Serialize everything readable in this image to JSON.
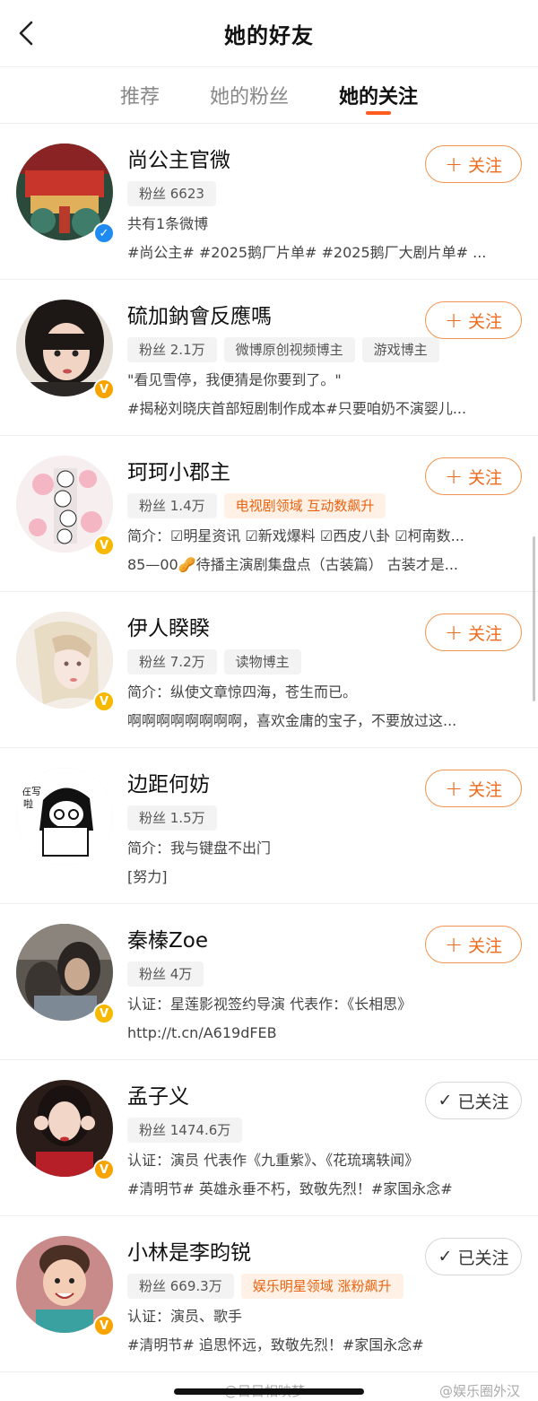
{
  "header": {
    "title": "她的好友",
    "back_icon": "chevron-left-icon"
  },
  "tabs": [
    {
      "label": "推荐",
      "active": false
    },
    {
      "label": "她的粉丝",
      "active": false
    },
    {
      "label": "她的关注",
      "active": true
    }
  ],
  "follow_label": "关注",
  "followed_label": "已关注",
  "items": [
    {
      "name": "尚公主官微",
      "verify": "blue",
      "tags": [
        "粉丝 6623"
      ],
      "hot": "",
      "line1": "共有1条微博",
      "line2": "#尚公主# #2025鹅厂片单# #2025鹅厂大剧片单# ...",
      "followed": false
    },
    {
      "name": "硫加鈉會反應嗎",
      "verify": "orange",
      "tags": [
        "粉丝 2.1万",
        "微博原创视频博主",
        "游戏博主"
      ],
      "hot": "",
      "line1": "\"看见雪停，我便猜是你要到了。\"",
      "line2": "#揭秘刘晓庆首部短剧制作成本#只要咱奶不演婴儿...",
      "followed": false
    },
    {
      "name": "珂珂小郡主",
      "verify": "gold",
      "tags": [
        "粉丝 1.4万"
      ],
      "hot": "电视剧领域 互动数飙升",
      "line1": "简介：☑明星资讯 ☑新戏爆料 ☑西皮八卦 ☑柯南数...",
      "line2": "85—00🥜待播主演剧集盘点（古装篇） 古装才是...",
      "followed": false
    },
    {
      "name": "伊人睽睽",
      "verify": "gold",
      "tags": [
        "粉丝 7.2万",
        "读物博主"
      ],
      "hot": "",
      "line1": "简介：纵使文章惊四海，苍生而已。",
      "line2": "啊啊啊啊啊啊啊啊，喜欢金庸的宝子，不要放过这...",
      "followed": false
    },
    {
      "name": "边距何妨",
      "verify": "",
      "tags": [
        "粉丝 1.5万"
      ],
      "hot": "",
      "line1": "简介：我与键盘不出门",
      "line2": "[努力]",
      "followed": false
    },
    {
      "name": "秦榛Zoe",
      "verify": "gold",
      "tags": [
        "粉丝 4万"
      ],
      "hot": "",
      "line1": "认证：星莲影视签约导演 代表作：《长相思》",
      "line2": "http://t.cn/A619dFEB",
      "followed": false
    },
    {
      "name": "孟子义",
      "verify": "orange",
      "tags": [
        "粉丝 1474.6万"
      ],
      "hot": "",
      "line1": "认证：演员 代表作《九重紫》、《花琉璃轶闻》",
      "line2": "#清明节# 英雄永垂不朽，致敬先烈！#家国永念#",
      "followed": true
    },
    {
      "name": "小林是李昀锐",
      "verify": "orange",
      "tags": [
        "粉丝 669.3万"
      ],
      "hot": "娱乐明星领域 涨粉飙升",
      "line1": "认证：演员、歌手",
      "line2": "#清明节# 追思怀远，致敬先烈！#家国永念#",
      "followed": true
    }
  ],
  "watermark": {
    "left": "@目目相映梦",
    "right": "@娱乐圈外汉"
  },
  "colors": {
    "accent": "#ff5b1f",
    "follow": "#ee6b1c",
    "verify_blue": "#1f8bf0",
    "verify_orange": "#f7a300"
  }
}
